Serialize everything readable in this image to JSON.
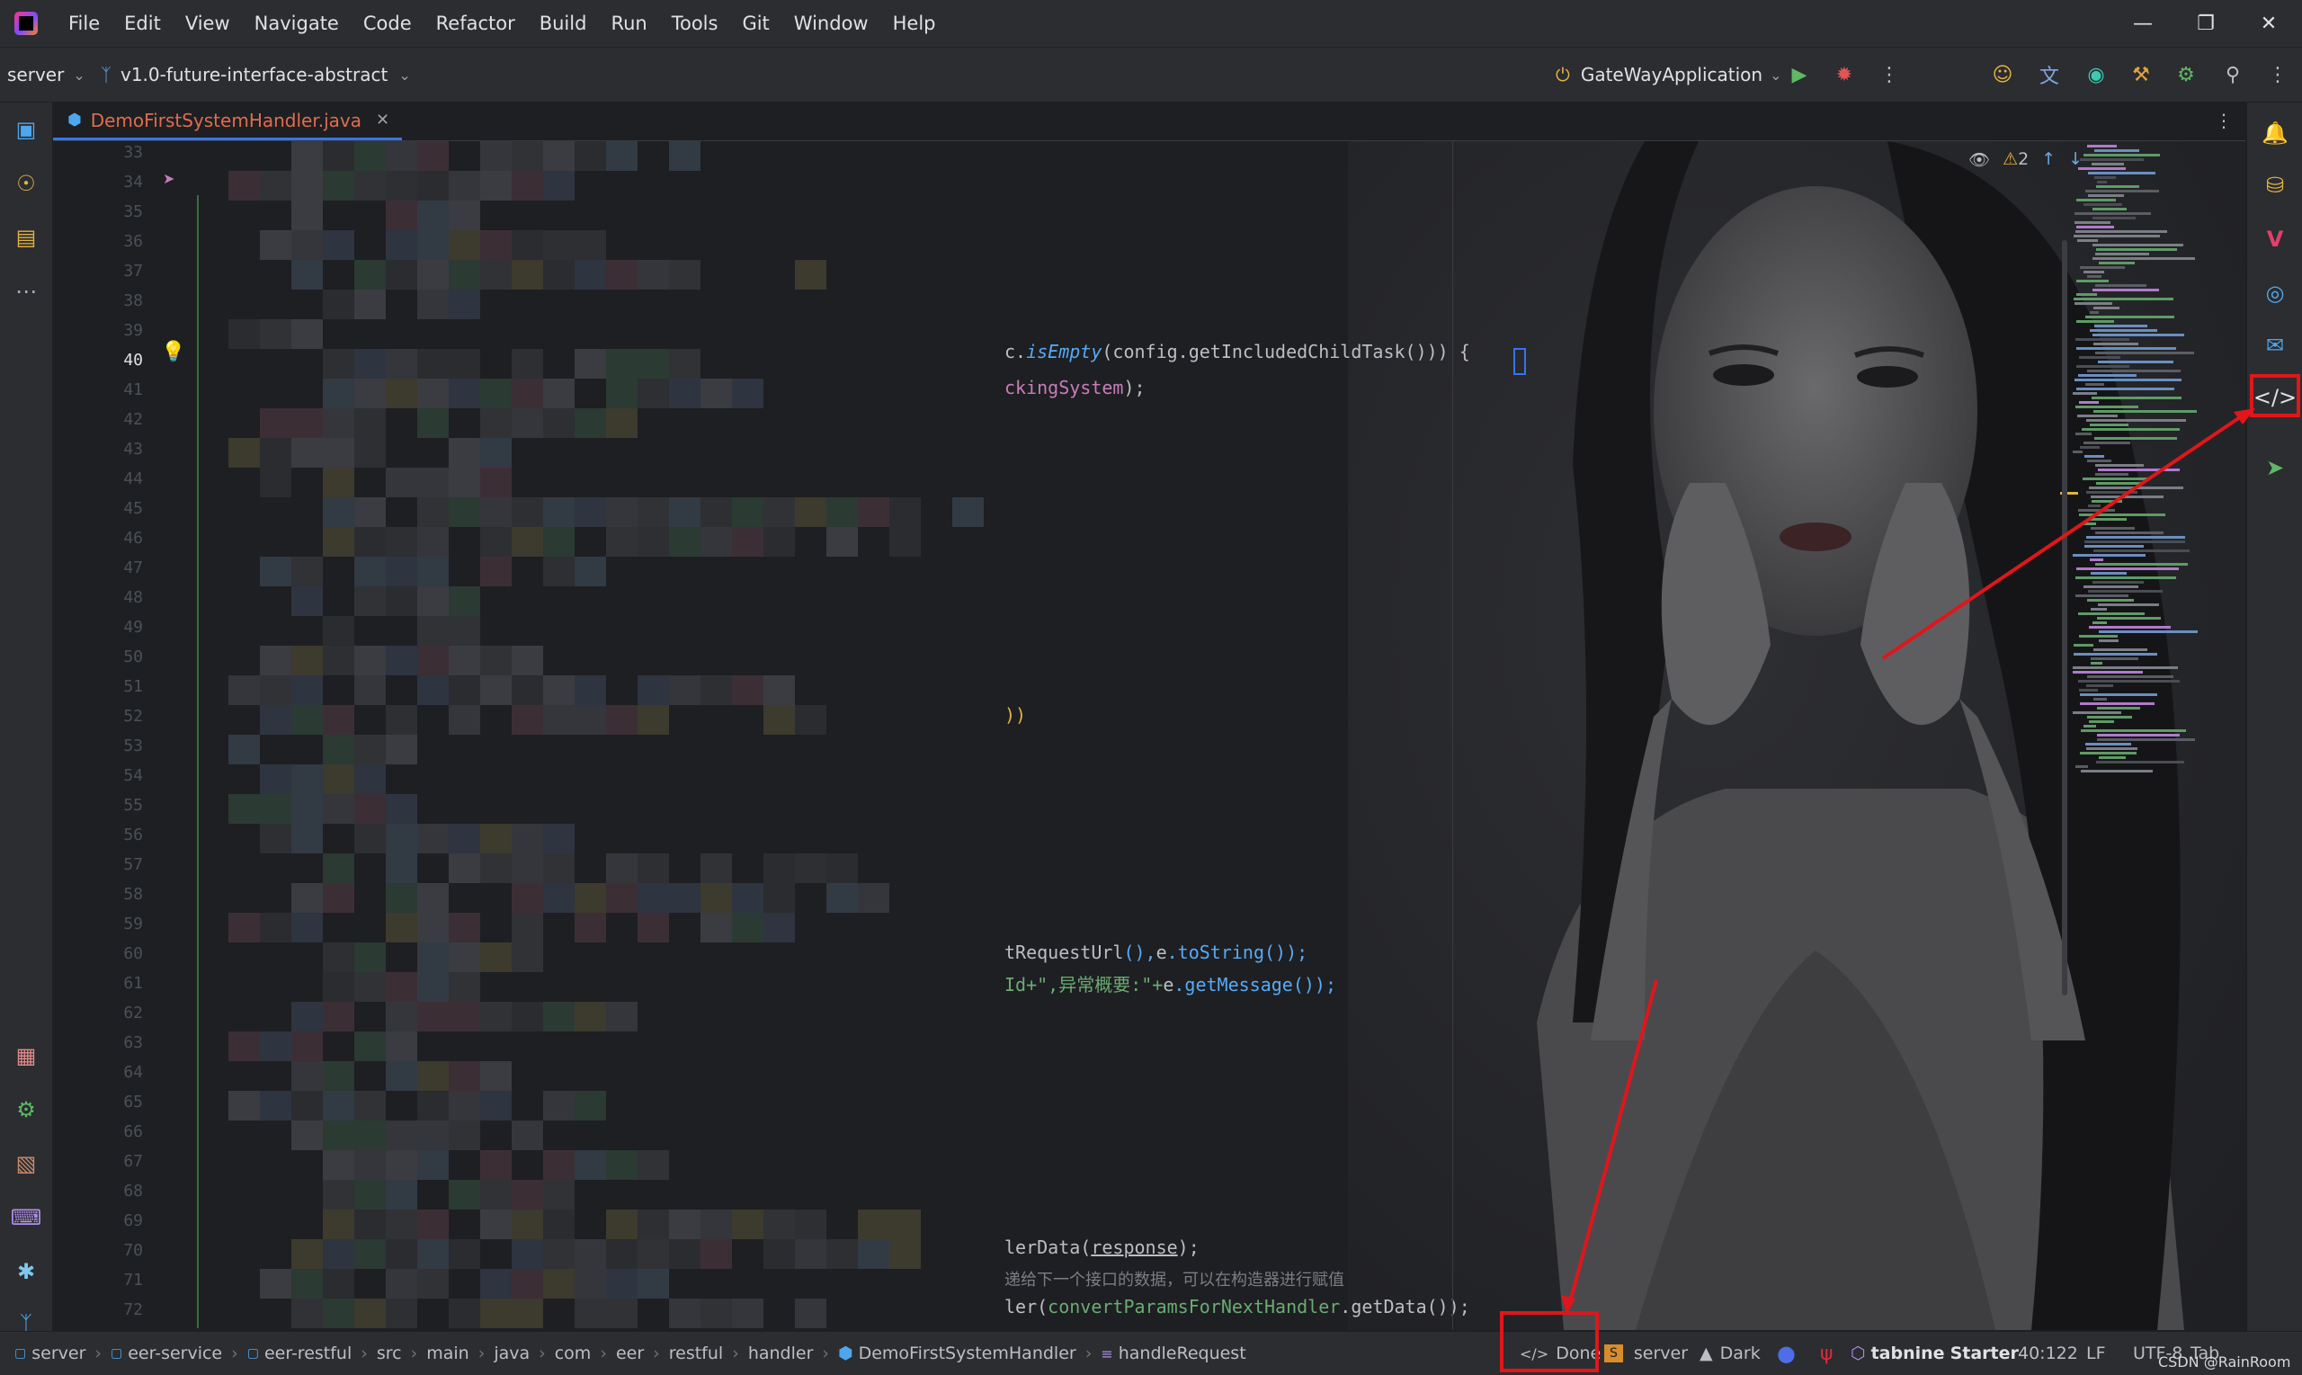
{
  "menu": [
    "File",
    "Edit",
    "View",
    "Navigate",
    "Code",
    "Refactor",
    "Build",
    "Run",
    "Tools",
    "Git",
    "Window",
    "Help"
  ],
  "toolbar": {
    "project": "server",
    "branch": "v1.0-future-interface-abstract",
    "run_config": "GateWayApplication"
  },
  "tab": {
    "filename": "DemoFirstSystemHandler.java"
  },
  "editor": {
    "line_numbers": [
      "33",
      "34",
      "35",
      "36",
      "37",
      "38",
      "39",
      "40",
      "41",
      "42",
      "43",
      "44",
      "45",
      "46",
      "47",
      "48",
      "49",
      "50",
      "51",
      "52",
      "53",
      "54",
      "55",
      "56",
      "57",
      "58",
      "59",
      "60",
      "61",
      "62",
      "63",
      "64",
      "65",
      "66",
      "67",
      "68",
      "69",
      "70",
      "71",
      "72"
    ],
    "current_line": "40",
    "warning_count": "2",
    "code_fragments": {
      "l40_a": "c.",
      "l40_b": "isEmpty",
      "l40_c": "(config.getIncludedChildTask())) {",
      "l41": "ckingSystem",
      "l41_end": ");",
      "l52": "))",
      "l60_a": "tRequestUrl",
      "l60_b": "(),",
      "l60_c": "e",
      "l60_d": ".toString());",
      "l61_a": "Id+\",异常概要:\"+",
      "l61_b": "e",
      "l61_c": ".getMessage());",
      "l70_a": "lerData(",
      "l70_b": "response",
      "l70_c": ");",
      "l71": "递给下一个接口的数据，可以在构造器进行赋值",
      "l72_a": "ler(",
      "l72_b": "convertParamsForNextHandler",
      "l72_c": ".getData());"
    }
  },
  "breadcrumbs": [
    "server",
    "eer-service",
    "eer-restful",
    "src",
    "main",
    "java",
    "com",
    "eer",
    "restful",
    "handler",
    "DemoFirstSystemHandler",
    "handleRequest"
  ],
  "status": {
    "done": "Done",
    "server": "server",
    "theme": "Dark",
    "tabnine_a": "tabnine",
    "tabnine_b": "Starter",
    "position": "40:122",
    "line_sep": "LF",
    "encoding": "UTF-8",
    "indent": "Tab",
    "watermark": "CSDN @RainRoom"
  },
  "colors": {
    "background": "#1e1f22",
    "panel": "#2b2d30",
    "accent": "#3574f0",
    "annotation_red": "#e0161b"
  }
}
